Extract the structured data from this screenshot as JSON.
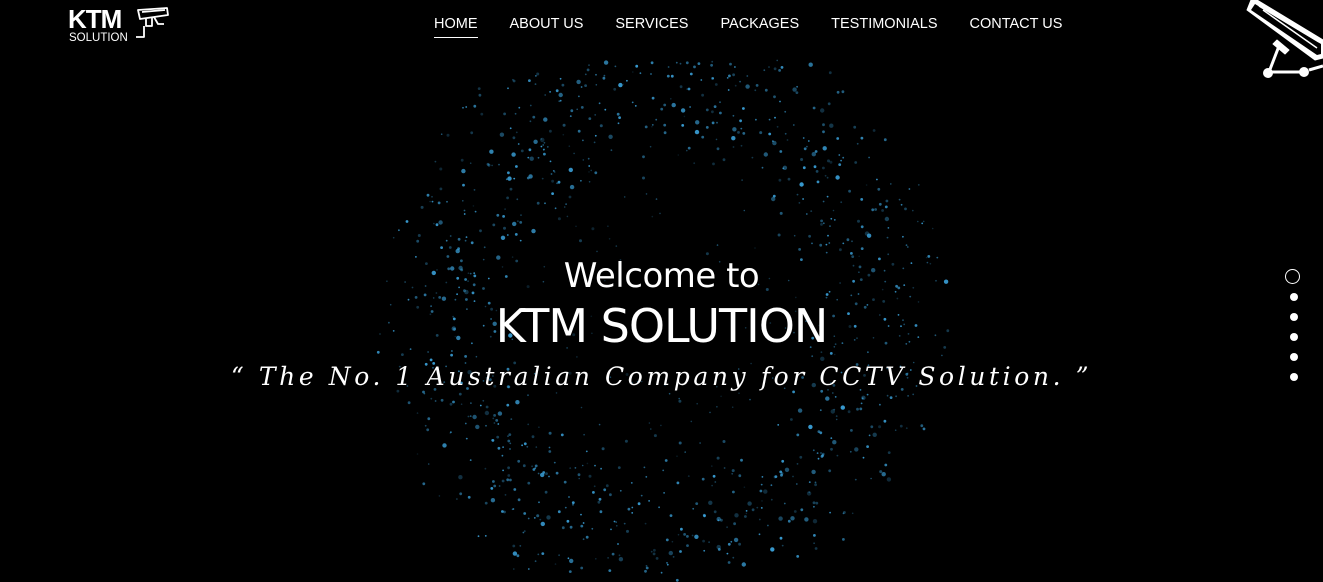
{
  "logo": {
    "name": "KTM",
    "sub": "SOLUTION"
  },
  "nav": {
    "items": [
      {
        "label": "HOME",
        "active": true
      },
      {
        "label": "ABOUT US",
        "active": false
      },
      {
        "label": "SERVICES",
        "active": false
      },
      {
        "label": "PACKAGES",
        "active": false
      },
      {
        "label": "TESTIMONIALS",
        "active": false
      },
      {
        "label": "CONTACT US",
        "active": false
      }
    ]
  },
  "hero": {
    "welcome": "Welcome to",
    "title": "KTM SOLUTION",
    "tagline": "“ The No. 1 Australian Company for CCTV Solution. ”"
  },
  "slider": {
    "total": 6,
    "active_index": 0
  },
  "colors": {
    "background": "#000000",
    "text": "#ffffff",
    "particle": "#3aa0d8"
  },
  "icons": {
    "logo_camera": "cctv-camera-icon",
    "corner_camera": "cctv-camera-icon"
  }
}
